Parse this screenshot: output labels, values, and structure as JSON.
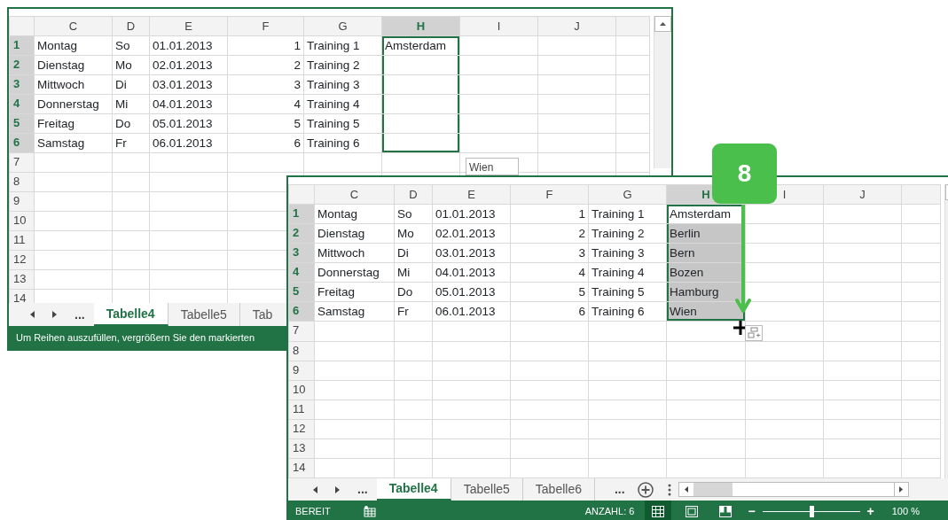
{
  "windows": [
    {
      "kind": "back",
      "columns": [
        {
          "label": "C",
          "selected": false
        },
        {
          "label": "D",
          "selected": false
        },
        {
          "label": "E",
          "selected": false
        },
        {
          "label": "F",
          "selected": false
        },
        {
          "label": "G",
          "selected": false
        },
        {
          "label": "H",
          "selected": true
        },
        {
          "label": "I",
          "selected": false
        },
        {
          "label": "J",
          "selected": false
        }
      ],
      "rows": [
        {
          "number": "1",
          "selected": true,
          "cells": [
            "Montag",
            "So",
            "01.01.2013",
            "1",
            "Training 1",
            "Amsterdam"
          ]
        },
        {
          "number": "2",
          "selected": true,
          "cells": [
            "Dienstag",
            "Mo",
            "02.01.2013",
            "2",
            "Training 2"
          ]
        },
        {
          "number": "3",
          "selected": true,
          "cells": [
            "Mittwoch",
            "Di",
            "03.01.2013",
            "3",
            "Training 3"
          ]
        },
        {
          "number": "4",
          "selected": true,
          "cells": [
            "Donnerstag",
            "Mi",
            "04.01.2013",
            "4",
            "Training 4"
          ]
        },
        {
          "number": "5",
          "selected": true,
          "cells": [
            "Freitag",
            "Do",
            "05.01.2013",
            "5",
            "Training 5"
          ]
        },
        {
          "number": "6",
          "selected": true,
          "cells": [
            "Samstag",
            "Fr",
            "06.01.2013",
            "6",
            "Training 6"
          ]
        },
        {
          "number": "7",
          "selected": false,
          "cells": []
        },
        {
          "number": "8",
          "selected": false,
          "cells": []
        },
        {
          "number": "9",
          "selected": false,
          "cells": []
        },
        {
          "number": "10",
          "selected": false,
          "cells": []
        },
        {
          "number": "11",
          "selected": false,
          "cells": []
        },
        {
          "number": "12",
          "selected": false,
          "cells": []
        },
        {
          "number": "13",
          "selected": false,
          "cells": []
        },
        {
          "number": "14",
          "selected": false,
          "cells": []
        }
      ],
      "selection_shaded": false,
      "tooltip": "Wien",
      "sheet_nav": "...",
      "tabs": [
        {
          "label": "Tabelle4",
          "selected": true
        },
        {
          "label": "Tabelle5",
          "selected": false
        },
        {
          "label": "Tab",
          "selected": false
        }
      ],
      "status_text": "Um Reihen auszufüllen, vergrößern Sie den markierten"
    },
    {
      "kind": "front",
      "columns": [
        {
          "label": "C",
          "selected": false
        },
        {
          "label": "D",
          "selected": false
        },
        {
          "label": "E",
          "selected": false
        },
        {
          "label": "F",
          "selected": false
        },
        {
          "label": "G",
          "selected": false
        },
        {
          "label": "H",
          "selected": true
        },
        {
          "label": "I",
          "selected": false
        },
        {
          "label": "J",
          "selected": false
        }
      ],
      "rows": [
        {
          "number": "1",
          "selected": true,
          "cells": [
            "Montag",
            "So",
            "01.01.2013",
            "1",
            "Training 1",
            "Amsterdam"
          ]
        },
        {
          "number": "2",
          "selected": true,
          "cells": [
            "Dienstag",
            "Mo",
            "02.01.2013",
            "2",
            "Training 2",
            "Berlin"
          ]
        },
        {
          "number": "3",
          "selected": true,
          "cells": [
            "Mittwoch",
            "Di",
            "03.01.2013",
            "3",
            "Training 3",
            "Bern"
          ]
        },
        {
          "number": "4",
          "selected": true,
          "cells": [
            "Donnerstag",
            "Mi",
            "04.01.2013",
            "4",
            "Training 4",
            "Bozen"
          ]
        },
        {
          "number": "5",
          "selected": true,
          "cells": [
            "Freitag",
            "Do",
            "05.01.2013",
            "5",
            "Training 5",
            "Hamburg"
          ]
        },
        {
          "number": "6",
          "selected": true,
          "cells": [
            "Samstag",
            "Fr",
            "06.01.2013",
            "6",
            "Training 6",
            "Wien"
          ]
        },
        {
          "number": "7",
          "selected": false,
          "cells": []
        },
        {
          "number": "8",
          "selected": false,
          "cells": []
        },
        {
          "number": "9",
          "selected": false,
          "cells": []
        },
        {
          "number": "10",
          "selected": false,
          "cells": []
        },
        {
          "number": "11",
          "selected": false,
          "cells": []
        },
        {
          "number": "12",
          "selected": false,
          "cells": []
        },
        {
          "number": "13",
          "selected": false,
          "cells": []
        },
        {
          "number": "14",
          "selected": false,
          "cells": []
        }
      ],
      "selection_shaded": true,
      "sheet_nav": "...",
      "tabs": [
        {
          "label": "Tabelle4",
          "selected": true
        },
        {
          "label": "Tabelle5",
          "selected": false
        },
        {
          "label": "Tabelle6",
          "selected": false
        }
      ],
      "more_tabs": "...",
      "status": {
        "mode": "BEREIT",
        "count": "ANZAHL: 6",
        "views": [
          {
            "kind": "normal",
            "selected": true
          },
          {
            "kind": "page-layout",
            "selected": false
          },
          {
            "kind": "page-break",
            "selected": false
          }
        ],
        "zoom_out": "−",
        "zoom_in": "+",
        "zoom": {
          "level": 0.5
        },
        "zoom_percent": "100 %"
      }
    }
  ],
  "callout": {
    "label": "8"
  }
}
